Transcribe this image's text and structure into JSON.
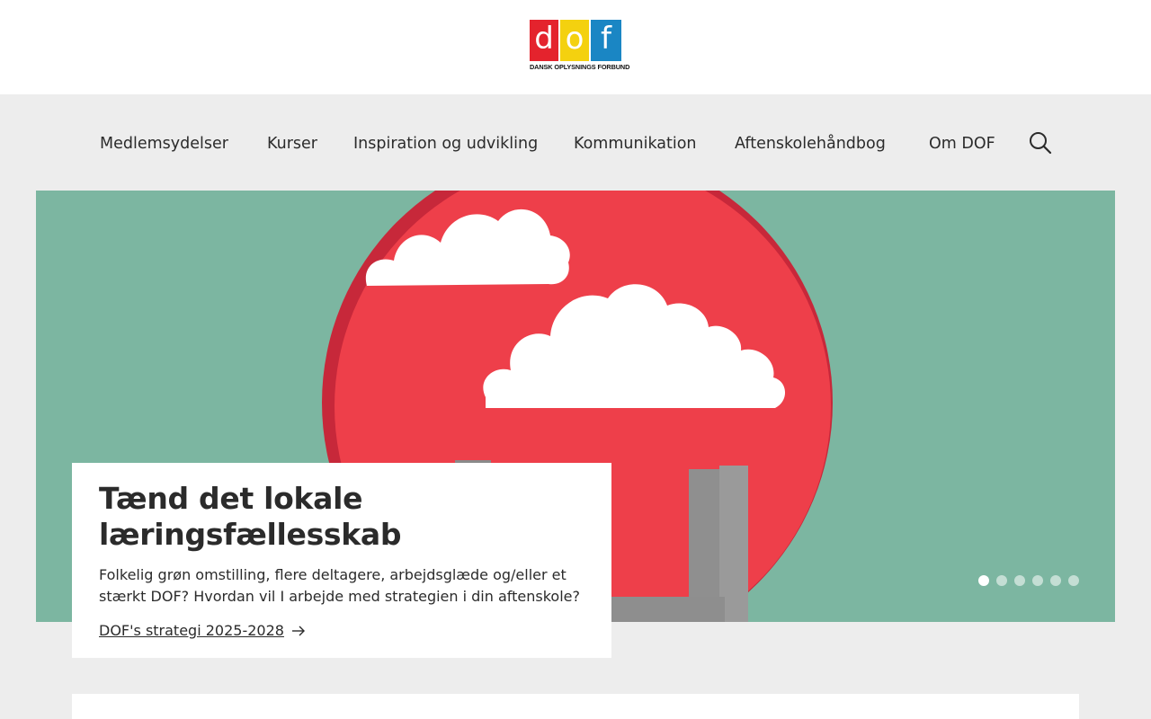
{
  "header": {
    "logo": {
      "letters": [
        "d",
        "o",
        "f"
      ],
      "subtitle": "DANSK OPLYSNINGS FORBUND",
      "colors": [
        "#e4232d",
        "#f4d10f",
        "#1a86c4"
      ]
    }
  },
  "nav": {
    "items": [
      {
        "label": "Medlemsydelser"
      },
      {
        "label": "Kurser"
      },
      {
        "label": "Inspiration og udvikling"
      },
      {
        "label": "Kommunikation"
      },
      {
        "label": "Aftenskolehåndbog"
      },
      {
        "label": "Om DOF"
      }
    ],
    "search_icon": "search-icon"
  },
  "hero": {
    "image": "red-circle-clouds-illustration",
    "colors": {
      "background": "#7fb8a4",
      "circle": "#ee3f4a",
      "clouds": "#ffffff"
    },
    "carousel": {
      "slides": 6,
      "active": 1
    },
    "card": {
      "title": "Tænd det lokale læringsfællesskab",
      "text": "Folkelig grøn omstilling, flere deltagere, arbejdsglæde og/eller et stærkt DOF? Hvordan vil I arbejde med strategien i din aftenskole?",
      "link_label": "DOF's strategi 2025-2028",
      "link_icon": "arrow-right-icon"
    }
  }
}
